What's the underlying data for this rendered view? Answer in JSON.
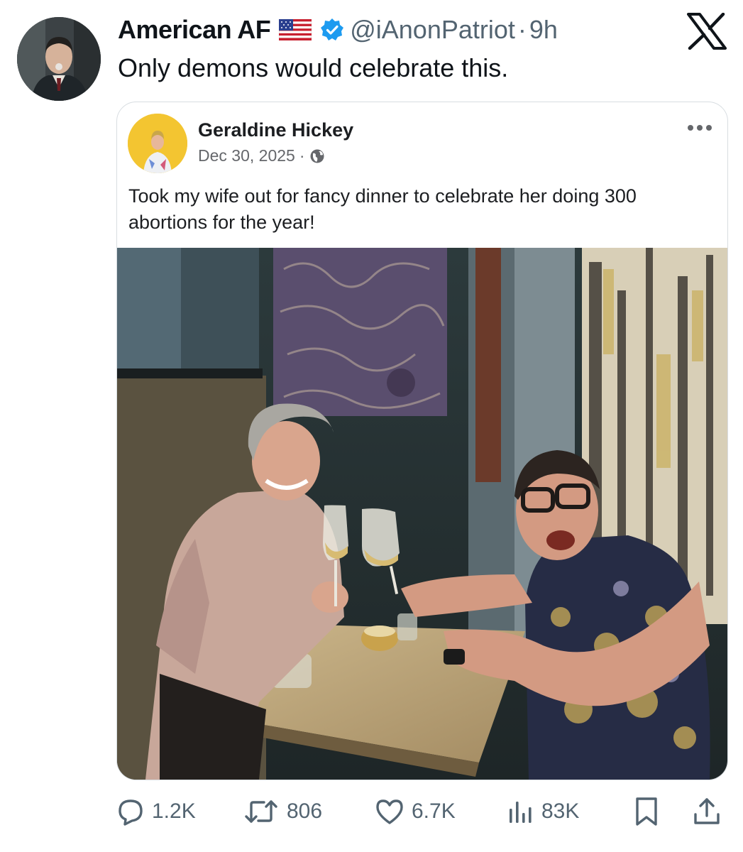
{
  "tweet": {
    "display_name": "American AF",
    "flag_icon": "us-flag-icon",
    "verified_icon": "verified-badge-icon",
    "handle": "@iAnonPatriot",
    "separator": "·",
    "time": "9h",
    "text": "Only demons would celebrate this."
  },
  "embedded_post": {
    "author": "Geraldine Hickey",
    "date": "Dec 30, 2025",
    "separator": "·",
    "audience_icon": "globe-icon",
    "text": "Took my wife out for fancy dinner to celebrate her doing 300 abortions for the year!"
  },
  "actions": {
    "replies": "1.2K",
    "reposts": "806",
    "likes": "6.7K",
    "views": "83K"
  },
  "colors": {
    "verified": "#1d9bf0",
    "muted_text": "#536471",
    "fb_muted": "#65676b"
  }
}
